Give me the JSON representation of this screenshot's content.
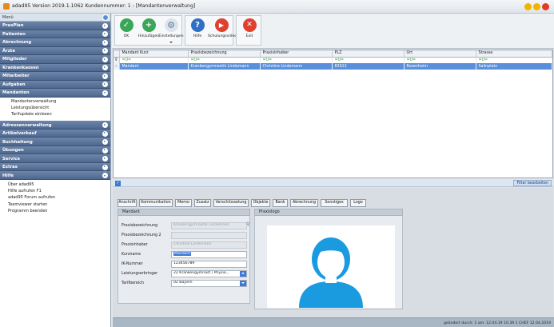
{
  "window": {
    "title": "adad95  Version 2019.1.1062  Kundennummer: 1 - [Mandantenverwaltung]"
  },
  "sidebar": {
    "header": "Menü",
    "sections": [
      {
        "label": "PraxPlan",
        "expanded": false
      },
      {
        "label": "Patienten",
        "expanded": false
      },
      {
        "label": "Abrechnung",
        "expanded": false
      },
      {
        "label": "Ärzte",
        "expanded": false
      },
      {
        "label": "Mitglieder",
        "expanded": false
      },
      {
        "label": "Krankenkassen",
        "expanded": false
      },
      {
        "label": "Mitarbeiter",
        "expanded": false
      },
      {
        "label": "Aufgaben",
        "expanded": false
      },
      {
        "label": "Mandanten",
        "expanded": true,
        "items": [
          "Mandantenverwaltung",
          "Leistungsübersicht",
          "Tarifupdate einlesen"
        ]
      },
      {
        "label": "Adressenverwaltung",
        "expanded": false
      },
      {
        "label": "Artikelverkauf",
        "expanded": false
      },
      {
        "label": "Buchhaltung",
        "expanded": false
      },
      {
        "label": "Übungen",
        "expanded": false
      },
      {
        "label": "Service",
        "expanded": false
      },
      {
        "label": "Extras",
        "expanded": false
      },
      {
        "label": "Hilfe",
        "expanded": true,
        "items": [
          "Über adad95",
          "Hilfe aufrufen F1",
          "adad95 Forum aufrufen",
          "Teamviewer starten",
          "Programm beenden"
        ]
      }
    ]
  },
  "toolbar": {
    "buttons": [
      {
        "label": "OK",
        "icon": "check-icon",
        "color": "#3aa657"
      },
      {
        "label": "Hinzufügen",
        "icon": "plus-icon",
        "color": "#3aa657"
      },
      {
        "label": "Einstellungen",
        "icon": "gears-icon",
        "color": "#6c8fb3"
      },
      {
        "label": "Hilfe",
        "icon": "question-icon",
        "color": "#2f6fc4"
      },
      {
        "label": "Schulungsvideos",
        "icon": "video-icon",
        "color": "#e0412f"
      },
      {
        "label": "Exit",
        "icon": "close-icon",
        "color": "#e0412f"
      }
    ]
  },
  "grid": {
    "columns": [
      "Mandant Kurz",
      "Praxisbezeichnung",
      "Praxisinhaber",
      "PLZ",
      "Ort",
      "Strasse"
    ],
    "filter_symbol": "=Ü=",
    "rows": [
      [
        "Mandant",
        "Krankengymnastik Lindemann",
        "Christine Lindemann",
        "83022",
        "Rosenheim",
        "Salinplatz"
      ]
    ]
  },
  "filterbar": {
    "button": "Filter bearbeiten"
  },
  "detail": {
    "tabs": [
      "Anschrift",
      "Kommunikation",
      "Memo",
      "Zusatz",
      "Verschlüsselung",
      "Objekte",
      "Bank",
      "Abrechnung",
      "Sonstiges",
      "Logo"
    ],
    "mandant_header": "Mandant",
    "logo_header": "Praxislogo",
    "fields": [
      {
        "label": "Praxisbezeichnung",
        "value": "Krankengymnastik Lindemann",
        "disabled": true
      },
      {
        "label": "Praxisbezeichnung 2",
        "value": "",
        "disabled": true
      },
      {
        "label": "Praxisinhaber",
        "value": "Christine Lindemann",
        "disabled": true
      },
      {
        "label": "Kurzname",
        "value": "Mandant",
        "disabled": false,
        "selected": true
      },
      {
        "label": "IK-Nummer",
        "value": "123456789",
        "disabled": false
      },
      {
        "label": "Leistungserbringer",
        "value": "22 Krankengymnast / Physio...",
        "disabled": false,
        "select": true
      },
      {
        "label": "Tarifbereich",
        "value": "02 Bayern",
        "disabled": false,
        "select": true
      }
    ]
  },
  "statusbar": {
    "text": "geändert durch: 1 am: 12.04.19 10.39    1    CHEF    12.04.2019"
  }
}
